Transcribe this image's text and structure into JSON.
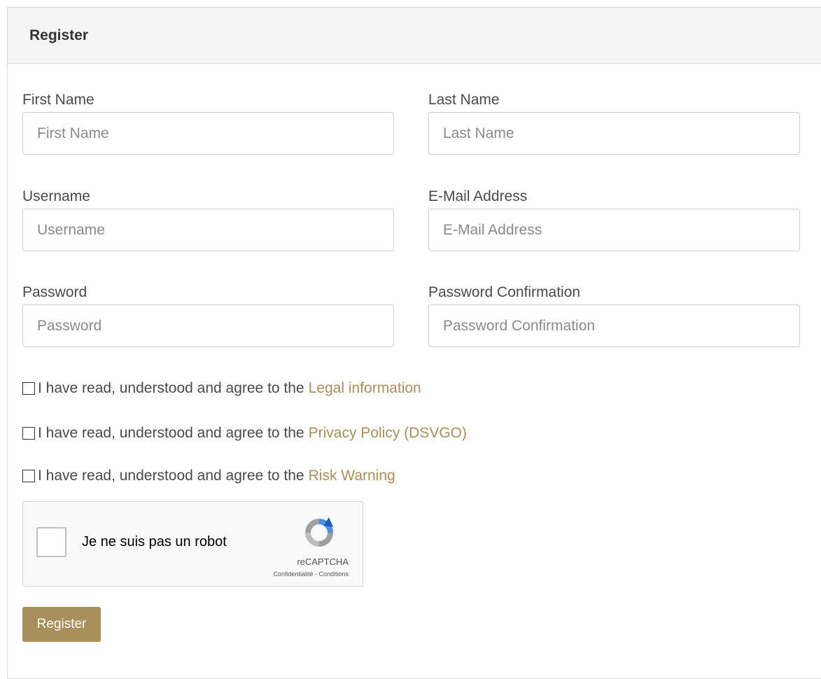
{
  "header": {
    "title": "Register"
  },
  "fields": {
    "first_name": {
      "label": "First Name",
      "placeholder": "First Name"
    },
    "last_name": {
      "label": "Last Name",
      "placeholder": "Last Name"
    },
    "username": {
      "label": "Username",
      "placeholder": "Username"
    },
    "email": {
      "label": "E-Mail Address",
      "placeholder": "E-Mail Address"
    },
    "password": {
      "label": "Password",
      "placeholder": "Password"
    },
    "password_confirmation": {
      "label": "Password Confirmation",
      "placeholder": "Password Confirmation"
    }
  },
  "agreements": [
    {
      "text": "I have read, understood and agree to the",
      "link": "Legal information"
    },
    {
      "text": "I have read, understood and agree to the",
      "link": "Privacy Policy (DSVGO)"
    },
    {
      "text": "I have read, understood and agree to the",
      "link": "Risk Warning"
    }
  ],
  "recaptcha": {
    "label": "Je ne suis pas un robot",
    "brand": "reCAPTCHA",
    "terms": "Confidentialité - Conditions"
  },
  "submit": {
    "label": "Register"
  },
  "colors": {
    "accent": "#a98f5c",
    "header_bg": "#f5f5f5",
    "border": "#dcdcdc"
  }
}
